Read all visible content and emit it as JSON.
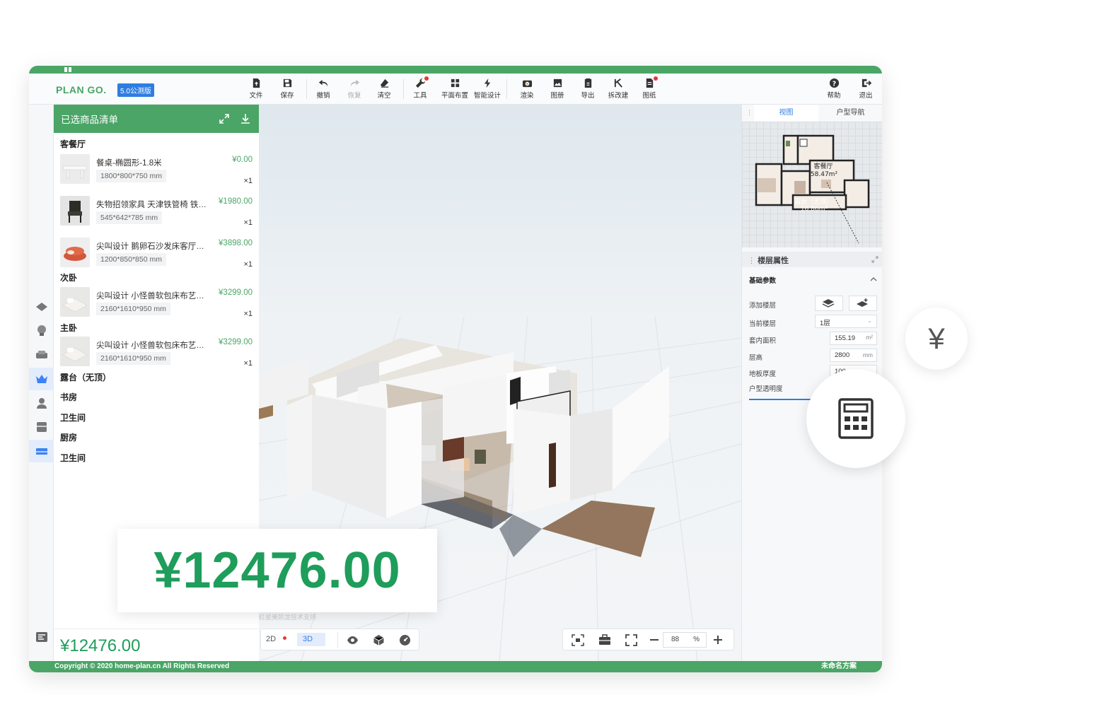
{
  "header": {
    "logo": "PLAN GO.",
    "version": "5.0公测版",
    "tools": [
      {
        "label": "文件",
        "icon": "file-icon"
      },
      {
        "label": "保存",
        "icon": "save-icon"
      },
      {
        "label": "撤销",
        "icon": "undo-icon"
      },
      {
        "label": "恢复",
        "icon": "redo-icon"
      },
      {
        "label": "清空",
        "icon": "eraser-icon"
      },
      {
        "label": "工具",
        "icon": "wrench-icon"
      },
      {
        "label": "平面布置",
        "icon": "layout-icon"
      },
      {
        "label": "智能设计",
        "icon": "lightning-icon"
      },
      {
        "label": "渲染",
        "icon": "camera-icon"
      },
      {
        "label": "图册",
        "icon": "album-icon"
      },
      {
        "label": "导出",
        "icon": "export-icon"
      },
      {
        "label": "拆改建",
        "icon": "demolish-icon"
      },
      {
        "label": "图纸",
        "icon": "drawing-icon"
      }
    ],
    "help": "帮助",
    "exit": "退出"
  },
  "list_panel": {
    "title": "已选商品清单",
    "rooms": [
      {
        "name": "客餐厅",
        "items": [
          {
            "name": "餐桌-椭圆形-1.8米",
            "price": "¥0.00",
            "size": "1800*800*750 mm",
            "qty": "×1"
          },
          {
            "name": "失物招领家具 天津铁管椅 铁…",
            "price": "¥1980.00",
            "size": "545*642*785 mm",
            "qty": "×1"
          },
          {
            "name": "尖叫设计 鹅卵石沙发床客厅…",
            "price": "¥3898.00",
            "size": "1200*850*850 mm",
            "qty": "×1"
          }
        ]
      },
      {
        "name": "次卧",
        "items": [
          {
            "name": "尖叫设计 小怪兽软包床布艺…",
            "price": "¥3299.00",
            "size": "2160*1610*950 mm",
            "qty": "×1"
          }
        ]
      },
      {
        "name": "主卧",
        "items": [
          {
            "name": "尖叫设计 小怪兽软包床布艺…",
            "price": "¥3299.00",
            "size": "2160*1610*950 mm",
            "qty": "×1"
          }
        ]
      },
      {
        "name": "露台（无顶）",
        "items": []
      },
      {
        "name": "书房",
        "items": []
      },
      {
        "name": "卫生间",
        "items": []
      },
      {
        "name": "厨房",
        "items": []
      },
      {
        "name": "卫生间",
        "items": []
      }
    ],
    "total": "¥12476.00"
  },
  "canvas": {
    "watermark": "红星美凯龙技术支持",
    "view_2d": "2D",
    "view_3d": "3D",
    "zoom": "88",
    "zoom_unit": "%"
  },
  "right_panel": {
    "tabs": [
      "视图",
      "户型导航"
    ],
    "map_labels": [
      "客餐厅",
      "58.47m²",
      "露台（无顶）",
      "16.86m²"
    ],
    "floor_title": "楼层属性",
    "basic_params": "基础参数",
    "rows": {
      "add_floor": "添加楼层",
      "current_floor": "当前楼层",
      "current_floor_value": "1层",
      "area": "套内面积",
      "area_value": "155.19",
      "area_unit": "m²",
      "height": "层高",
      "height_value": "2800",
      "height_unit": "mm",
      "floor_thickness": "地板厚度",
      "floor_thickness_value": "100",
      "transparency": "户型透明度"
    }
  },
  "footer": {
    "copyright": "Copyright © 2020 home-plan.cn All Rights Reserved",
    "plan_name": "未命名方案"
  },
  "overlay": {
    "big_price": "¥12476.00",
    "yen_symbol": "¥"
  },
  "colors": {
    "brand": "#4aa566",
    "price": "#1e9d5b",
    "accent": "#2f7de1"
  }
}
